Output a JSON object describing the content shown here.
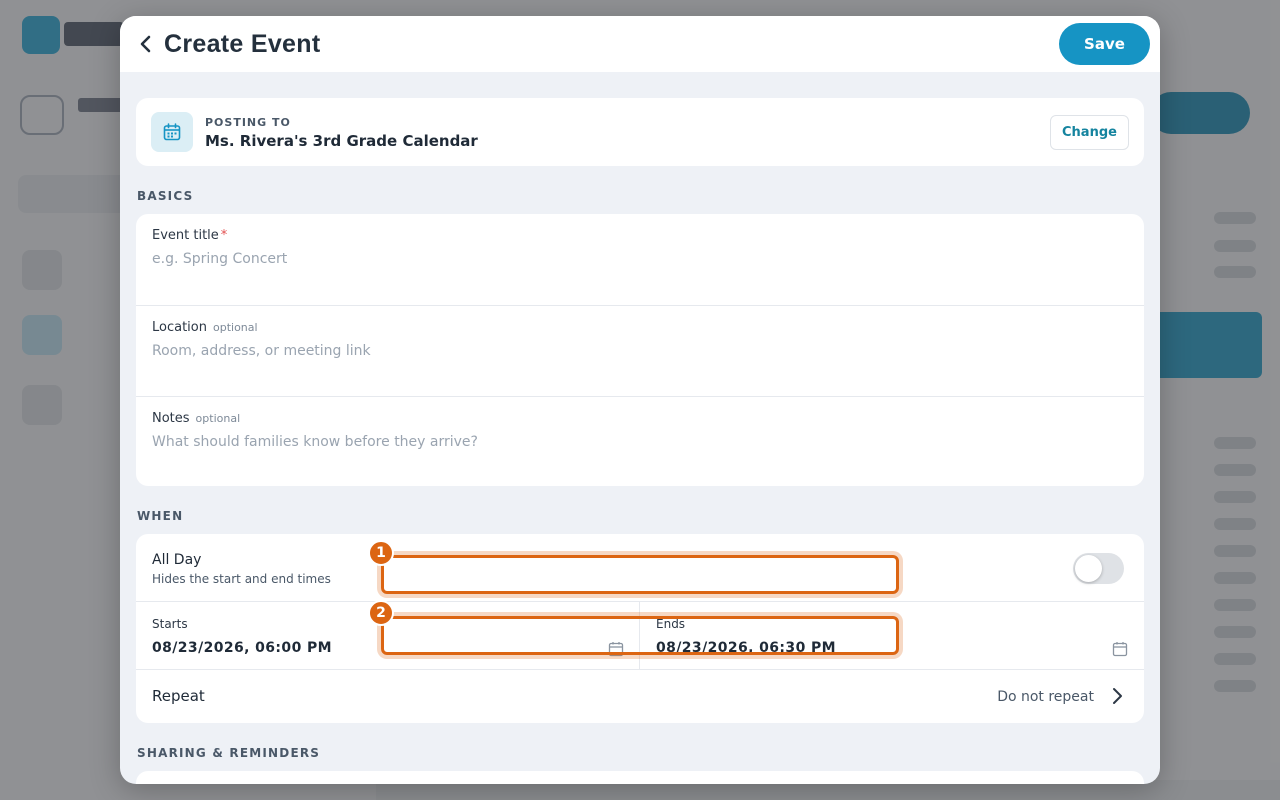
{
  "header": {
    "title": "Create Event",
    "save_label": "Save"
  },
  "posting": {
    "label": "POSTING TO",
    "calendar": "Ms. Rivera's 3rd Grade Calendar",
    "change_label": "Change"
  },
  "basics": {
    "section_title": "BASICS",
    "title_field": {
      "label": "Event title",
      "required_mark": "*",
      "placeholder": "e.g. Spring Concert",
      "value": ""
    },
    "location_field": {
      "label": "Location",
      "optional": "optional",
      "placeholder": "Room, address, or meeting link",
      "value": ""
    },
    "notes_field": {
      "label": "Notes",
      "optional": "optional",
      "placeholder": "What should families know before they arrive?",
      "value": ""
    }
  },
  "when": {
    "section_title": "WHEN",
    "all_day": {
      "label": "All Day",
      "sublabel": "Hides the start and end times",
      "on": false
    },
    "starts": {
      "label": "Starts",
      "value": "08/23/2026, 06:00 PM"
    },
    "ends": {
      "label": "Ends",
      "value": "08/23/2026, 06:30 PM"
    },
    "repeat": {
      "label": "Repeat",
      "value": "Do not repeat"
    }
  },
  "sharing": {
    "section_title": "SHARING & REMINDERS"
  },
  "annotations": [
    {
      "number": "1"
    },
    {
      "number": "2"
    }
  ],
  "colors": {
    "accent": "#1694c4",
    "marker": "#dc6512",
    "background": "#eef1f6"
  }
}
